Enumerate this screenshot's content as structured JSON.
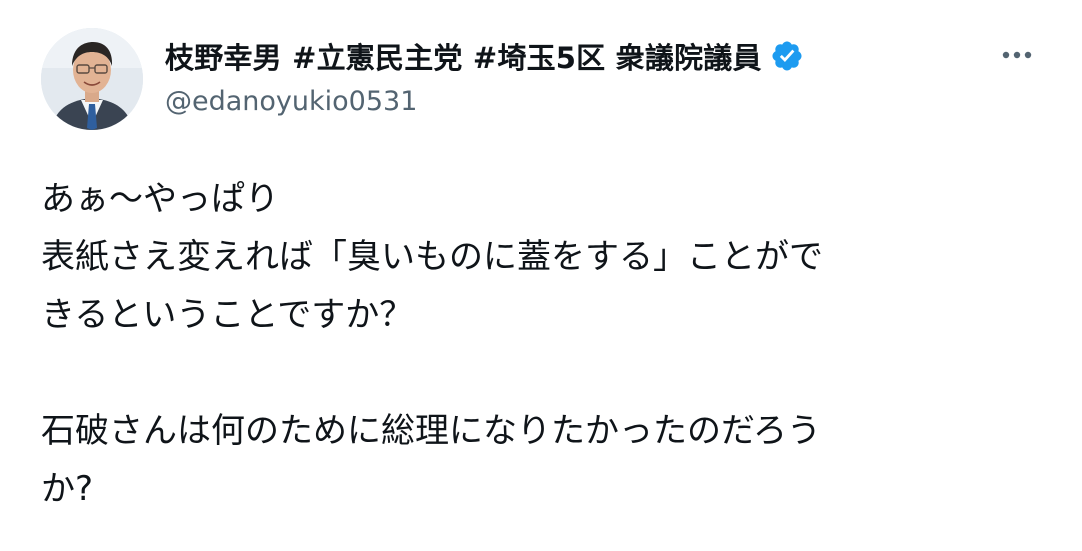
{
  "author": {
    "display_name": "枝野幸男 #立憲民主党 #埼玉5区 衆議院議員",
    "handle": "@edanoyukio0531",
    "verified_icon": "verified-badge-icon",
    "verified_color": "#1d9bf0"
  },
  "actions": {
    "more_icon": "more-horizontal-icon"
  },
  "tweet": {
    "paragraph1": {
      "line1": "あぁ〜やっぱり",
      "line2": "表紙さえ変えれば「臭いものに蓋をする」ことがで",
      "line3": "きるということですか？"
    },
    "paragraph2": {
      "line1": "石破さんは何のために総理になりたかったのだろう",
      "line2": "か?"
    }
  },
  "colors": {
    "text": "#0f1419",
    "secondary_text": "#536471",
    "background": "#ffffff"
  }
}
